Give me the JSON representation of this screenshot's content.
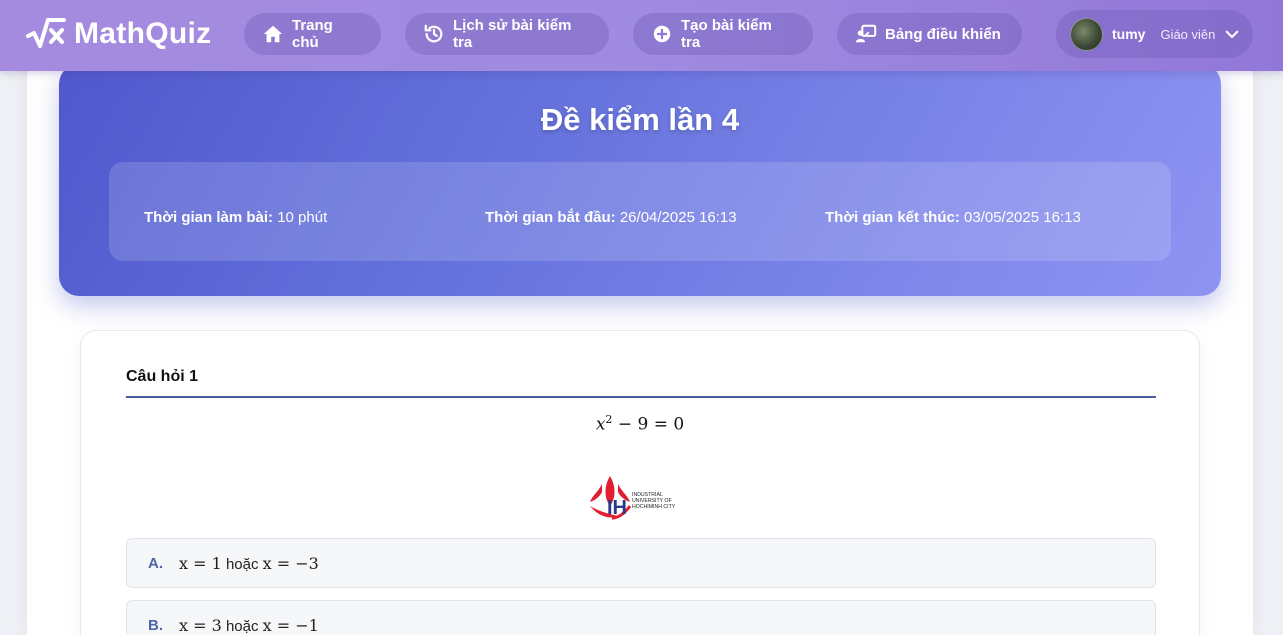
{
  "navbar": {
    "brand": "MathQuiz",
    "items": [
      {
        "label": "Trang chủ",
        "icon": "home-icon"
      },
      {
        "label": "Lịch sử bài kiểm tra",
        "icon": "history-icon"
      },
      {
        "label": "Tạo bài kiểm tra",
        "icon": "plus-circle-icon"
      },
      {
        "label": "Bảng điều khiển",
        "icon": "dashboard-icon"
      }
    ],
    "user": {
      "name": "tumy",
      "role": "Giáo viên"
    }
  },
  "quiz": {
    "title": "Đề kiểm lần 4",
    "duration_label": "Thời gian làm bài:",
    "duration_value": "10 phút",
    "start_label": "Thời gian bắt đầu:",
    "start_value": "26/04/2025 16:13",
    "end_label": "Thời gian kết thúc:",
    "end_value": "03/05/2025 16:13"
  },
  "question": {
    "title": "Câu hỏi 1",
    "equation": {
      "var": "x",
      "exp": "2",
      "rest": "− 9 = 0"
    },
    "logo_text": [
      "INDUSTRIAL",
      "UNIVERSITY OF",
      "HOCHIMINH CITY"
    ],
    "logo_mark": "IH",
    "options": [
      {
        "letter": "A.",
        "m1": "x = 1",
        "mid": "hoặc",
        "m2": "x = −3"
      },
      {
        "letter": "B.",
        "m1": "x = 3",
        "mid": "hoặc",
        "m2": "x = −1"
      }
    ]
  },
  "colors": {
    "navbar": "#9f8be0",
    "header_start": "#5058cc",
    "header_end": "#8f94f2",
    "option_letter": "#4a68a8"
  }
}
